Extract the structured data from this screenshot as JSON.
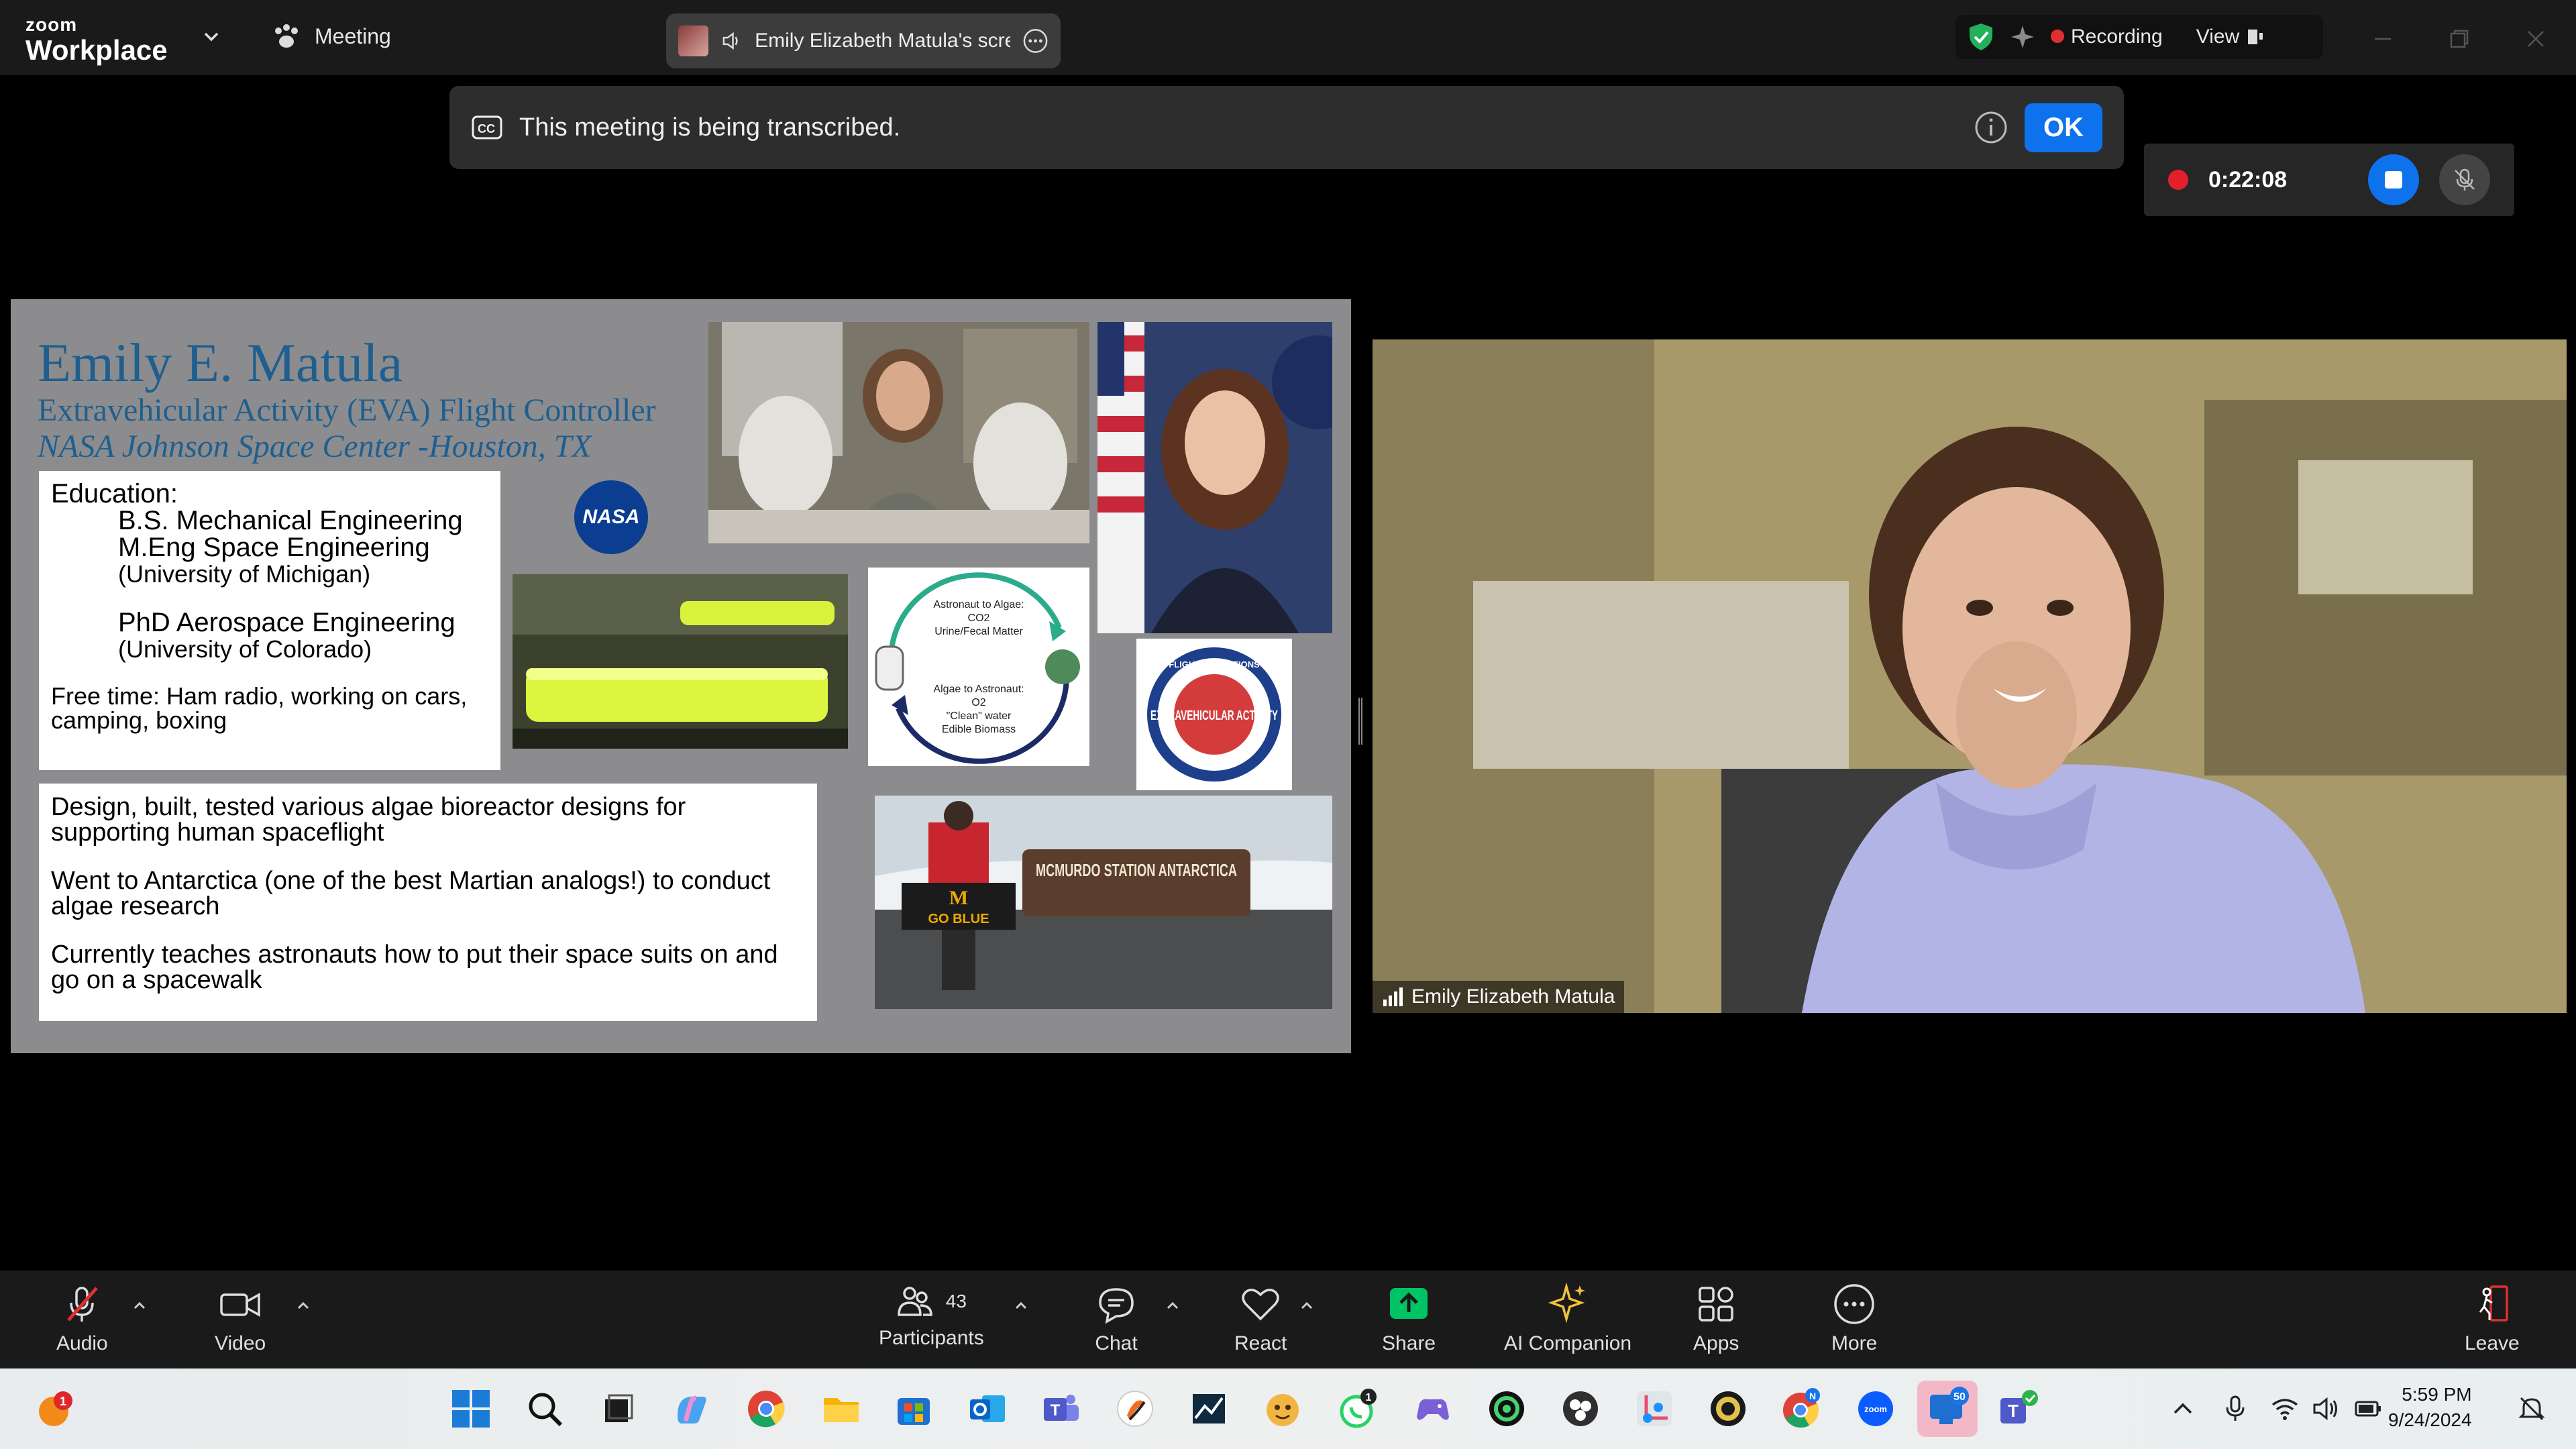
{
  "titlebar": {
    "brand_small": "zoom",
    "brand_big": "Workplace",
    "meeting_label": "Meeting",
    "screen_share_label": "Emily Elizabeth Matula's scre",
    "recording_label": "Recording",
    "view_label": "View"
  },
  "banner": {
    "message": "This meeting is being transcribed.",
    "ok_label": "OK"
  },
  "recording_widget": {
    "elapsed": "0:22:08"
  },
  "slide": {
    "name": "Emily E. Matula",
    "role": "Extravehicular Activity (EVA) Flight Controller",
    "center": "NASA Johnson Space Center -Houston, TX",
    "education_heading": "Education:",
    "degree1": "B.S. Mechanical Engineering",
    "degree2": "M.Eng Space Engineering",
    "school1": "(University of Michigan)",
    "degree3": "PhD Aerospace Engineering",
    "school2": "(University of Colorado)",
    "freetime": "Free time: Ham radio, working on cars, camping, boxing",
    "fact1": "Design, built, tested various algae bioreactor designs for supporting human spaceflight",
    "fact2": "Went to Antarctica (one of the best Martian analogs!) to conduct algae research",
    "fact3": "Currently teaches astronauts how to put their space suits on and go on a spacewalk",
    "nasa_logo_text": "NASA",
    "diagram": {
      "top_label": "Astronaut to Algae:",
      "top_l2": "CO2",
      "top_l3": "Urine/Fecal Matter",
      "bottom_label": "Algae to Astronaut:",
      "bottom_l2": "O2",
      "bottom_l3": "\"Clean\" water",
      "bottom_l4": "Edible Biomass"
    },
    "patch_text": "EXTRAVEHICULAR ACTIVITY",
    "patch_top": "FLIGHT OPERATIONS",
    "antarctica_sign": "MCMURDO STATION ANTARCTICA",
    "banner_letter": "M",
    "banner_text": "GO BLUE"
  },
  "video": {
    "participant_name": "Emily Elizabeth Matula"
  },
  "toolbar": {
    "audio": "Audio",
    "video": "Video",
    "participants": "Participants",
    "participants_count": "43",
    "chat": "Chat",
    "react": "React",
    "share": "Share",
    "ai_companion": "AI Companion",
    "apps": "Apps",
    "more": "More",
    "leave": "Leave"
  },
  "taskbar": {
    "notif_badge": "1",
    "whatsapp_badge": "1",
    "outlook_badge": "50",
    "chrome_badge": "N",
    "time": "5:59 PM",
    "date": "9/24/2024"
  },
  "colors": {
    "zoom_blue": "#0e72ed",
    "record_red": "#e3202a",
    "share_green": "#00c364",
    "slide_title": "#1f5f8f"
  }
}
